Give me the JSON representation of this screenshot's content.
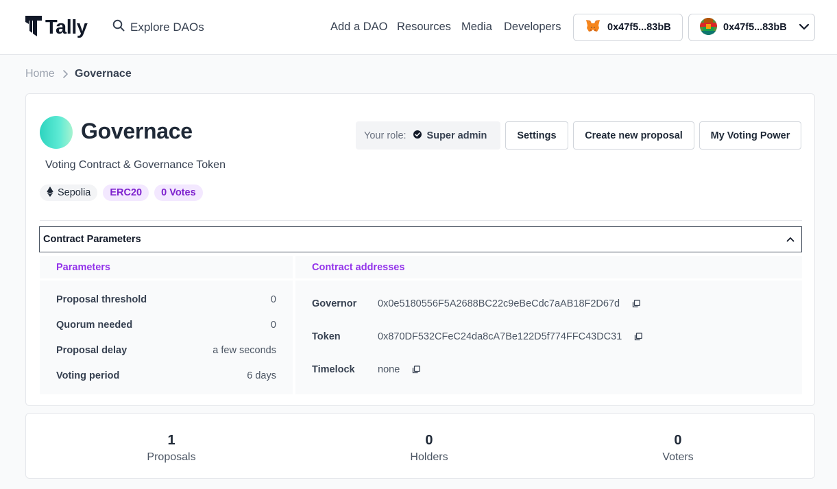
{
  "header": {
    "logo_text": "Tally",
    "search_label": "Explore DAOs",
    "nav": [
      "Add a DAO",
      "Resources",
      "Media",
      "Developers"
    ],
    "wallet_short": "0x47f5...83bB",
    "account_short": "0x47f5...83bB"
  },
  "breadcrumb": {
    "home": "Home",
    "current": "Governace"
  },
  "dao": {
    "name": "Governace",
    "description": "Voting Contract & Governance Token",
    "network": "Sepolia",
    "token_type": "ERC20",
    "votes": "0 Votes",
    "role_label": "Your role:",
    "role_value": "Super admin",
    "settings_label": "Settings",
    "create_proposal_label": "Create new proposal",
    "voting_power_label": "My Voting Power"
  },
  "contract": {
    "section_title": "Contract Parameters",
    "parameters_title": "Parameters",
    "addresses_title": "Contract addresses",
    "parameters": [
      {
        "key": "Proposal threshold",
        "value": "0"
      },
      {
        "key": "Quorum needed",
        "value": "0"
      },
      {
        "key": "Proposal delay",
        "value": "a few seconds"
      },
      {
        "key": "Voting period",
        "value": "6 days"
      }
    ],
    "addresses": [
      {
        "key": "Governor",
        "value": "0x0e5180556F5A2688BC22c9eBeCdc7aAB18F2D67d"
      },
      {
        "key": "Token",
        "value": "0x870DF532CFeC24da8cA7Be122D5f774FFC43DC31"
      },
      {
        "key": "Timelock",
        "value": "none"
      }
    ]
  },
  "stats": [
    {
      "value": "1",
      "label": "Proposals"
    },
    {
      "value": "0",
      "label": "Holders"
    },
    {
      "value": "0",
      "label": "Voters"
    }
  ],
  "colors": {
    "accent": "#9333ea",
    "chip_bg": "#f3e8ff",
    "avatar_gradient_start": "#2dd4bf"
  }
}
